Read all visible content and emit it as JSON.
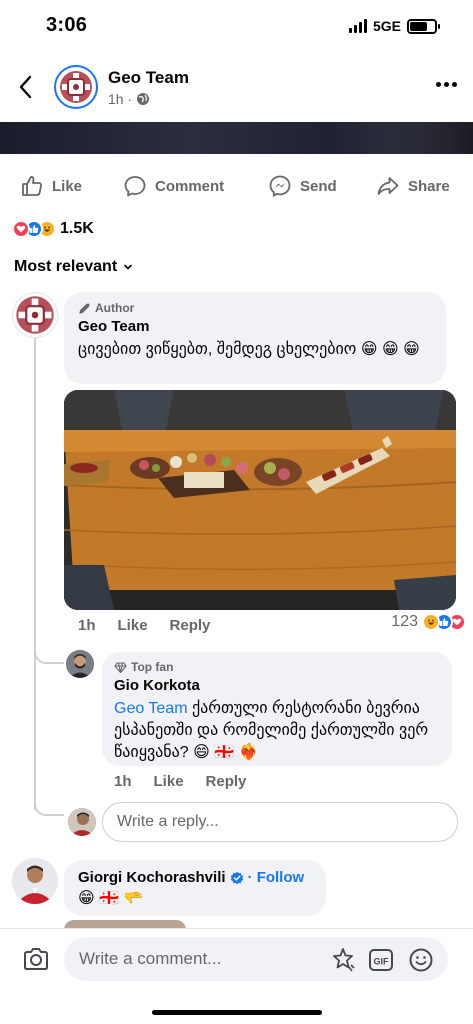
{
  "status": {
    "time": "3:06",
    "network": "5GE"
  },
  "header": {
    "page_name": "Geo Team",
    "time": "1h ·"
  },
  "actions": {
    "like": "Like",
    "comment": "Comment",
    "send": "Send",
    "share": "Share"
  },
  "reactions": {
    "count": "1.5K",
    "types": [
      "love",
      "like",
      "haha"
    ]
  },
  "sort": {
    "label": "Most relevant"
  },
  "comments": [
    {
      "badge": "Author",
      "author": "Geo Team",
      "text": "ცივებით ვიწყებთ, შემდეგ ცხელებიო 😁 😁 😁",
      "time": "1h",
      "like": "Like",
      "reply": "Reply",
      "reaction_count": "123"
    },
    {
      "badge": "Top fan",
      "author": "Gio Korkota",
      "mention": "Geo Team",
      "text": " ქართული რესტორანი ბევრია ესპანეთში და რომელიმე ქართულში ვერ წაიყვანა? 😄 🇬🇪 ❤️‍🔥",
      "time": "1h",
      "like": "Like",
      "reply": "Reply"
    },
    {
      "author": "Giorgi Kochorashvili",
      "follow": "· Follow",
      "text": "😁 🇬🇪 🫳"
    }
  ],
  "reply_input": {
    "placeholder": "Write a reply..."
  },
  "composer": {
    "placeholder": "Write a comment..."
  },
  "colors": {
    "accent": "#1877f2",
    "secondary_text": "#65676b",
    "bubble": "#f0f2f5"
  }
}
